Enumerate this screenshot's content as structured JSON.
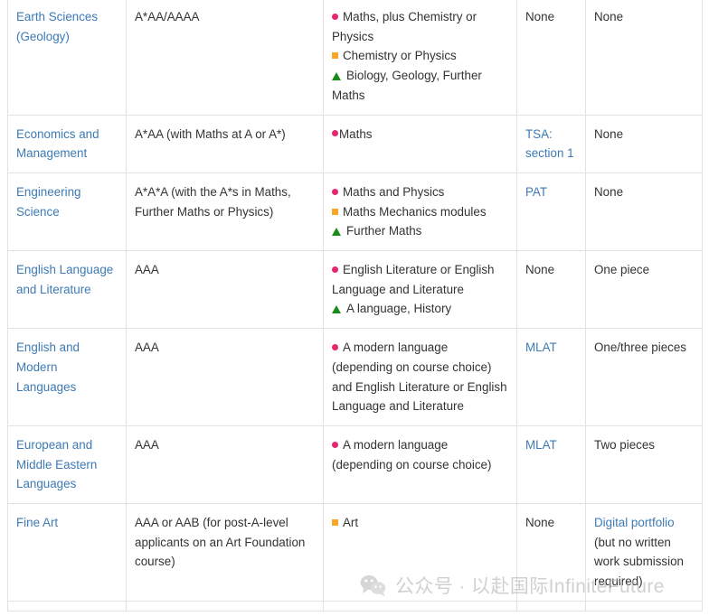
{
  "colors": {
    "link": "#3d7ab5",
    "border": "#e2e2e2",
    "text": "#333333",
    "marker_circle": "#e6266f",
    "marker_square": "#f5a623",
    "marker_triangle": "#1a8a1a",
    "watermark": "#b4b4b4"
  },
  "watermark": {
    "icon": "wechat-logo-icon",
    "text": "公众号 · 以赴国际InfiniteFuture"
  },
  "table": {
    "rows": [
      {
        "course": "Earth Sciences (Geology)",
        "course_link": true,
        "grades": "A*AA/AAAA",
        "subject_lines": [
          {
            "marker": "circle",
            "text": "Maths, plus Chemistry or Physics"
          },
          {
            "marker": "square",
            "text": "Chemistry or Physics"
          },
          {
            "marker": "triangle",
            "text": "Biology, Geology, Further Maths"
          }
        ],
        "test": "None",
        "test_link": false,
        "work": "None",
        "work_link": false
      },
      {
        "course": "Economics and Management",
        "course_link": true,
        "grades": "A*AA (with Maths at A or A*)",
        "subject_lines": [
          {
            "marker": "circle-tight",
            "text": "Maths"
          }
        ],
        "test": "TSA: section 1",
        "test_link": true,
        "work": "None",
        "work_link": false
      },
      {
        "course": "Engineering Science",
        "course_link": true,
        "grades": "A*A*A (with the A*s in Maths, Further Maths or Physics)",
        "subject_lines": [
          {
            "marker": "circle",
            "text": "Maths and Physics"
          },
          {
            "marker": "square",
            "text": "Maths Mechanics modules"
          },
          {
            "marker": "triangle",
            "text": "Further Maths"
          }
        ],
        "test": "PAT",
        "test_link": true,
        "work": "None",
        "work_link": false
      },
      {
        "course": "English Language and Literature",
        "course_link": true,
        "grades": "AAA",
        "subject_lines": [
          {
            "marker": "circle",
            "text": "English Literature or English Language and Literature"
          },
          {
            "marker": "triangle",
            "text": "A language, History"
          }
        ],
        "test": "None",
        "test_link": false,
        "work": "One piece",
        "work_link": false
      },
      {
        "course": "English and Modern Languages",
        "course_link": true,
        "grades": "AAA",
        "subject_lines": [
          {
            "marker": "circle",
            "text": "A modern language (depending on course choice) and English Literature or English Language and Literature"
          }
        ],
        "test": "MLAT",
        "test_link": true,
        "work": "One/three pieces",
        "work_link": false
      },
      {
        "course": "European and Middle Eastern Languages",
        "course_link": true,
        "grades": "AAA",
        "subject_lines": [
          {
            "marker": "circle",
            "text": "A modern language (depending on course choice)"
          }
        ],
        "test": "MLAT",
        "test_link": true,
        "work": "Two pieces",
        "work_link": false
      },
      {
        "course": "Fine Art",
        "course_link": true,
        "grades": "AAA or AAB (for post-A-level applicants on an Art Foundation course)",
        "subject_lines": [
          {
            "marker": "square",
            "text": "Art"
          }
        ],
        "test": "None",
        "test_link": false,
        "work_link_text": "Digital portfolio",
        "work_rest": " (but no written work submission required)"
      }
    ]
  }
}
